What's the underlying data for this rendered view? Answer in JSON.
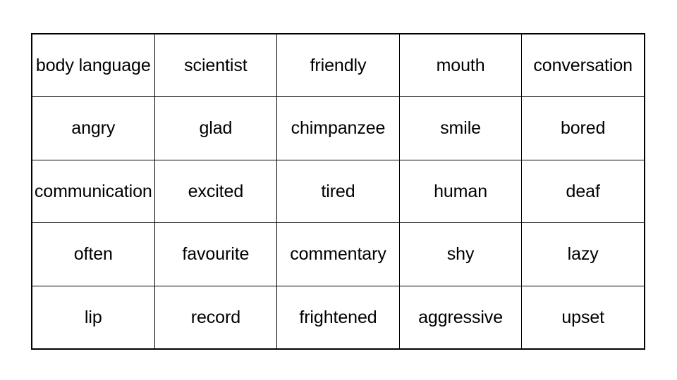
{
  "page": {
    "background_color": "#ffffff",
    "text_color": "#000000",
    "border_color": "#000000"
  },
  "grid": {
    "rows": 5,
    "columns": 5,
    "cells": [
      [
        "body language",
        "scientist",
        "friendly",
        "mouth",
        "conversation"
      ],
      [
        "angry",
        "glad",
        "chimpanzee",
        "smile",
        "bored"
      ],
      [
        "communication",
        "excited",
        "tired",
        "human",
        "deaf"
      ],
      [
        "often",
        "favourite",
        "commentary",
        "shy",
        "lazy"
      ],
      [
        "lip",
        "record",
        "frightened",
        "aggressive",
        "upset"
      ]
    ]
  }
}
